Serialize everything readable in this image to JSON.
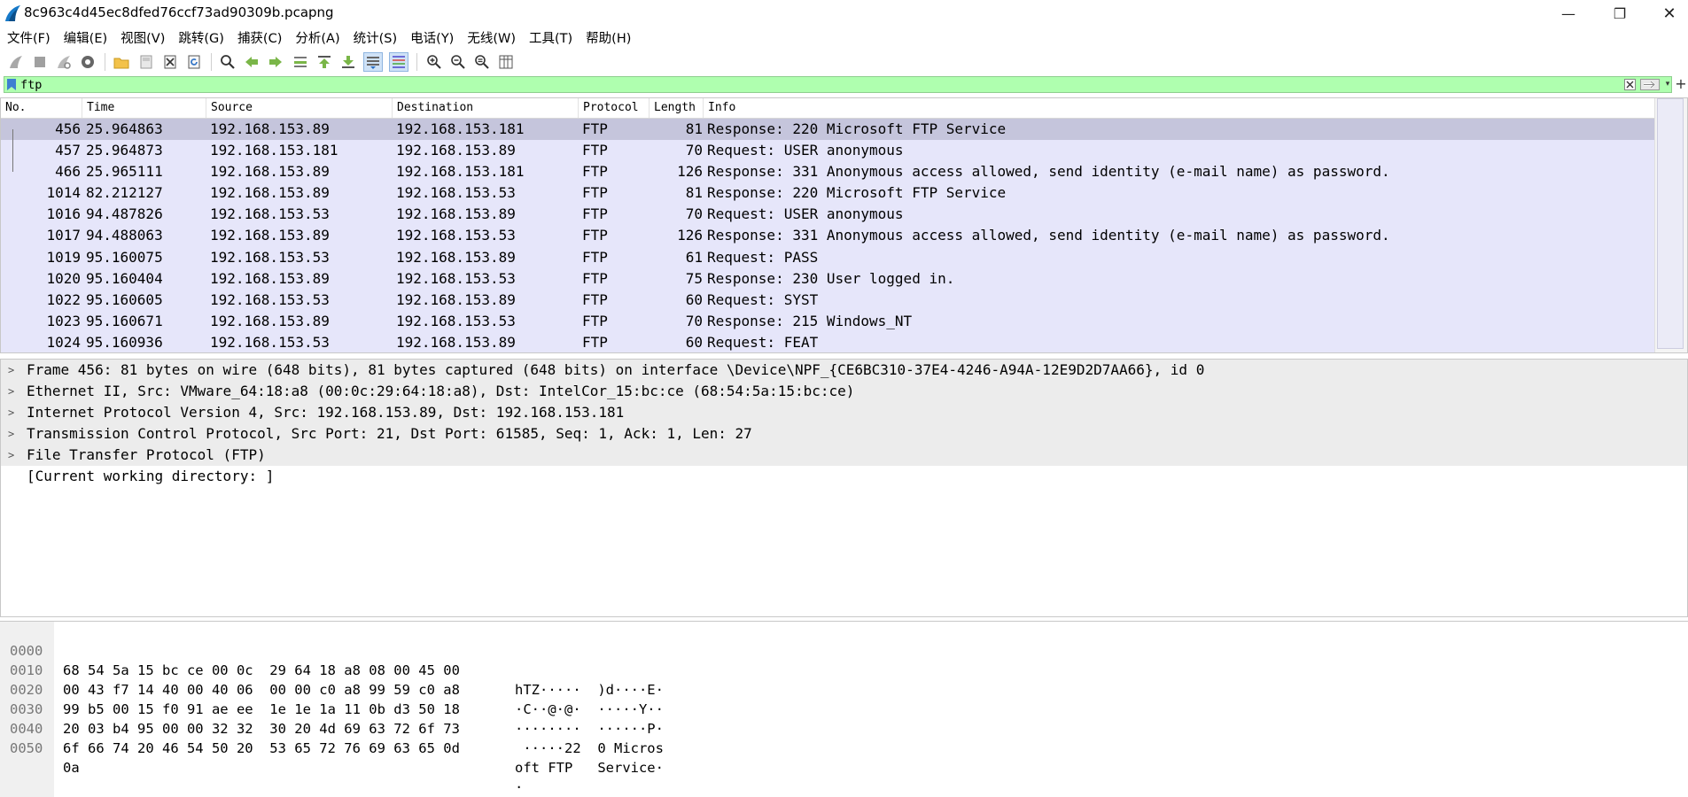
{
  "window": {
    "title": "8c963c4d45ec8dfed76ccf73ad90309b.pcapng",
    "minimize": "—",
    "maximize": "❐",
    "close": "✕",
    "app_icon": "wireshark-fin-icon"
  },
  "menu": [
    "文件(F)",
    "编辑(E)",
    "视图(V)",
    "跳转(G)",
    "捕获(C)",
    "分析(A)",
    "统计(S)",
    "电话(Y)",
    "无线(W)",
    "工具(T)",
    "帮助(H)"
  ],
  "toolbar_icons": [
    "start-capture-icon",
    "stop-capture-icon",
    "restart-capture-icon",
    "capture-options-icon",
    "open-file-icon",
    "save-file-icon",
    "close-file-icon",
    "reload-file-icon",
    "find-packet-icon",
    "go-back-icon",
    "go-forward-icon",
    "go-to-packet-icon",
    "go-first-icon",
    "go-last-icon",
    "autoscroll-icon",
    "colorize-icon",
    "zoom-in-icon",
    "zoom-out-icon",
    "zoom-normal-icon",
    "resize-columns-icon"
  ],
  "filter": {
    "value": "ftp",
    "bg_color": "#afffaf"
  },
  "packet_list": {
    "columns": [
      "No.",
      "Time",
      "Source",
      "Destination",
      "Protocol",
      "Length",
      "Info"
    ],
    "rows": [
      {
        "no": "456",
        "time": "25.964863",
        "src": "192.168.153.89",
        "dst": "192.168.153.181",
        "proto": "FTP",
        "len": "81",
        "info": "Response: 220 Microsoft FTP Service"
      },
      {
        "no": "457",
        "time": "25.964873",
        "src": "192.168.153.181",
        "dst": "192.168.153.89",
        "proto": "FTP",
        "len": "70",
        "info": "Request: USER anonymous"
      },
      {
        "no": "466",
        "time": "25.965111",
        "src": "192.168.153.89",
        "dst": "192.168.153.181",
        "proto": "FTP",
        "len": "126",
        "info": "Response: 331 Anonymous access allowed, send identity (e-mail name) as password."
      },
      {
        "no": "1014",
        "time": "82.212127",
        "src": "192.168.153.89",
        "dst": "192.168.153.53",
        "proto": "FTP",
        "len": "81",
        "info": "Response: 220 Microsoft FTP Service"
      },
      {
        "no": "1016",
        "time": "94.487826",
        "src": "192.168.153.53",
        "dst": "192.168.153.89",
        "proto": "FTP",
        "len": "70",
        "info": "Request: USER anonymous"
      },
      {
        "no": "1017",
        "time": "94.488063",
        "src": "192.168.153.89",
        "dst": "192.168.153.53",
        "proto": "FTP",
        "len": "126",
        "info": "Response: 331 Anonymous access allowed, send identity (e-mail name) as password."
      },
      {
        "no": "1019",
        "time": "95.160075",
        "src": "192.168.153.53",
        "dst": "192.168.153.89",
        "proto": "FTP",
        "len": "61",
        "info": "Request: PASS"
      },
      {
        "no": "1020",
        "time": "95.160404",
        "src": "192.168.153.89",
        "dst": "192.168.153.53",
        "proto": "FTP",
        "len": "75",
        "info": "Response: 230 User logged in."
      },
      {
        "no": "1022",
        "time": "95.160605",
        "src": "192.168.153.53",
        "dst": "192.168.153.89",
        "proto": "FTP",
        "len": "60",
        "info": "Request: SYST"
      },
      {
        "no": "1023",
        "time": "95.160671",
        "src": "192.168.153.89",
        "dst": "192.168.153.53",
        "proto": "FTP",
        "len": "70",
        "info": "Response: 215 Windows_NT"
      },
      {
        "no": "1024",
        "time": "95.160936",
        "src": "192.168.153.53",
        "dst": "192.168.153.89",
        "proto": "FTP",
        "len": "60",
        "info": "Request: FEAT"
      }
    ],
    "row_color": "#e6e6fa",
    "selected_color": "#c5c5dc"
  },
  "details": [
    {
      "expandable": true,
      "text": "Frame 456: 81 bytes on wire (648 bits), 81 bytes captured (648 bits) on interface \\Device\\NPF_{CE6BC310-37E4-4246-A94A-12E9D2D7AA66}, id 0"
    },
    {
      "expandable": true,
      "text": "Ethernet II, Src: VMware_64:18:a8 (00:0c:29:64:18:a8), Dst: IntelCor_15:bc:ce (68:54:5a:15:bc:ce)"
    },
    {
      "expandable": true,
      "text": "Internet Protocol Version 4, Src: 192.168.153.89, Dst: 192.168.153.181"
    },
    {
      "expandable": true,
      "text": "Transmission Control Protocol, Src Port: 21, Dst Port: 61585, Seq: 1, Ack: 1, Len: 27"
    },
    {
      "expandable": true,
      "text": "File Transfer Protocol (FTP)"
    },
    {
      "expandable": false,
      "text": "[Current working directory: ]"
    }
  ],
  "bytes": [
    {
      "offset": "0000",
      "hex": "68 54 5a 15 bc ce 00 0c  29 64 18 a8 08 00 45 00",
      "ascii": "hTZ·····  )d····E·"
    },
    {
      "offset": "0010",
      "hex": "00 43 f7 14 40 00 40 06  00 00 c0 a8 99 59 c0 a8",
      "ascii": "·C··@·@·  ·····Y··"
    },
    {
      "offset": "0020",
      "hex": "99 b5 00 15 f0 91 ae ee  1e 1e 1a 11 0b d3 50 18",
      "ascii": "········  ······P·"
    },
    {
      "offset": "0030",
      "hex": "20 03 b4 95 00 00 32 32  30 20 4d 69 63 72 6f 73",
      "ascii": " ·····22  0 Micros"
    },
    {
      "offset": "0040",
      "hex": "6f 66 74 20 46 54 50 20  53 65 72 76 69 63 65 0d",
      "ascii": "oft FTP   Service·"
    },
    {
      "offset": "0050",
      "hex": "0a",
      "ascii": "·"
    }
  ]
}
